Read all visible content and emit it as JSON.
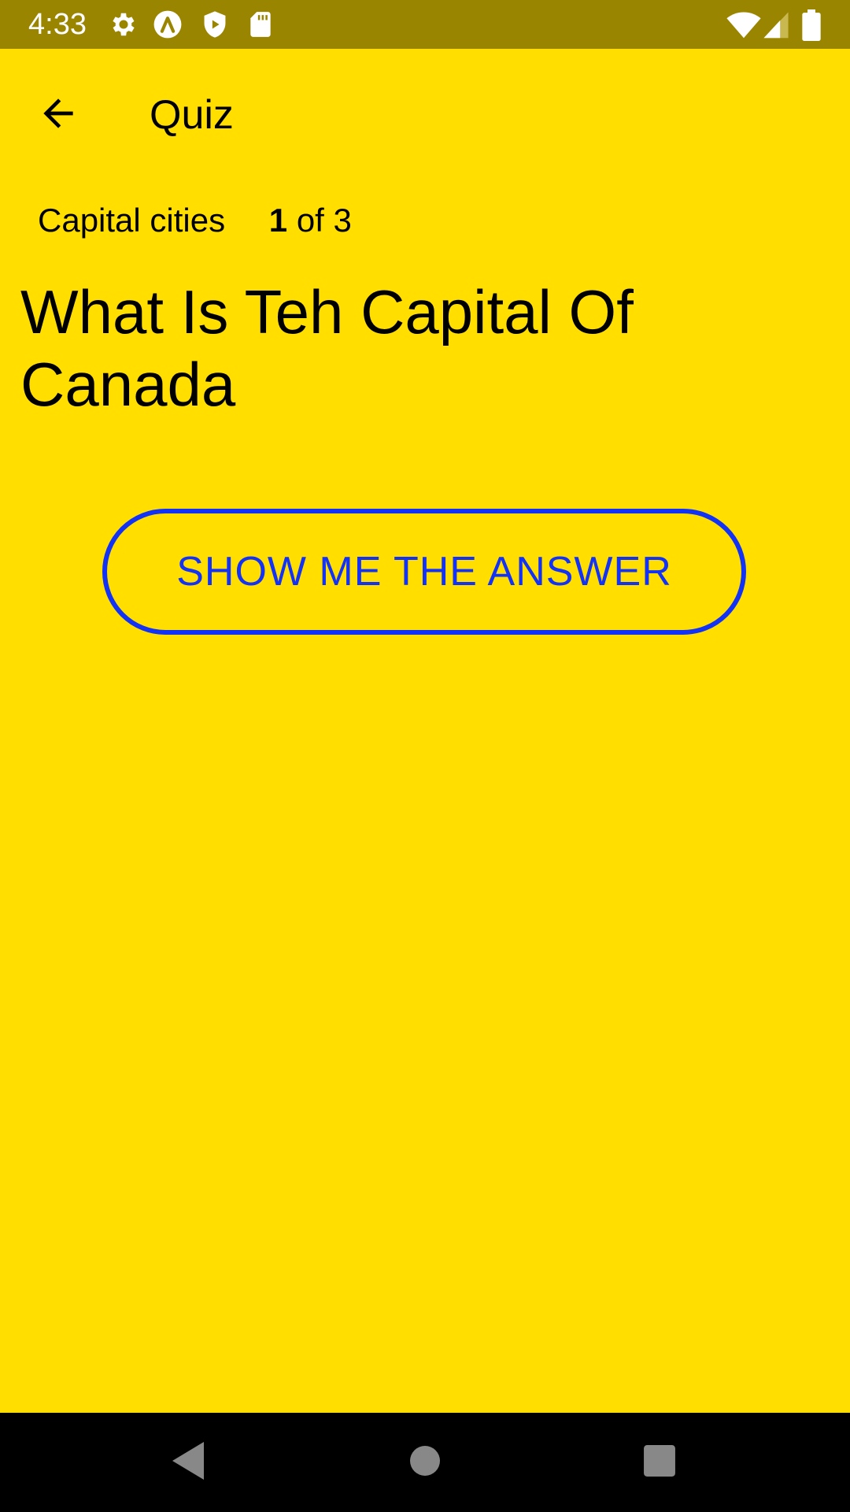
{
  "status_bar": {
    "time": "4:33",
    "left_icons": [
      "settings-icon",
      "accessibility-lambda-icon",
      "shield-icon",
      "sd-card-icon"
    ],
    "right_icons": [
      "wifi-icon",
      "cellular-signal-icon",
      "battery-icon"
    ]
  },
  "app_bar": {
    "back_icon": "arrow-back-icon",
    "title": "Quiz"
  },
  "quiz": {
    "category": "Capital cities",
    "current": "1",
    "of_total": "of 3",
    "question": "What Is Teh Capital Of Canada",
    "answer_button_label": "SHOW ME THE ANSWER"
  },
  "nav_bar": {
    "icons": [
      "nav-back-icon",
      "nav-home-icon",
      "nav-recents-icon"
    ]
  },
  "colors": {
    "background": "#FFDE00",
    "status_bar": "#9A8500",
    "accent": "#1232F5",
    "nav_bar": "#000000"
  }
}
